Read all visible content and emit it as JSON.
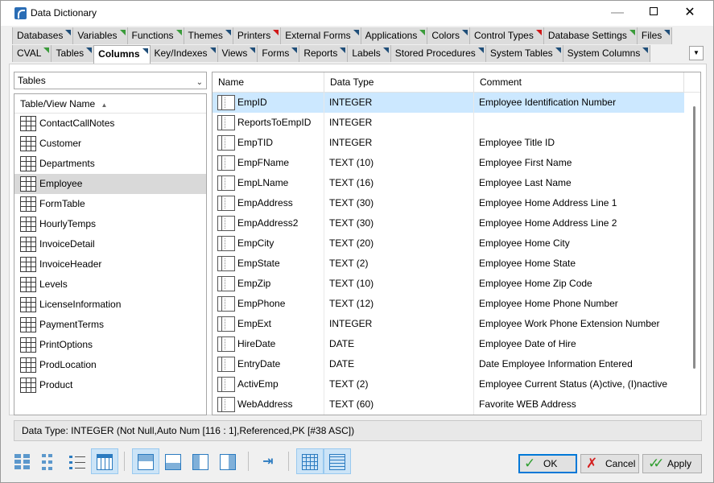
{
  "window": {
    "title": "Data Dictionary"
  },
  "tabs_row1": [
    {
      "label": "Databases",
      "flag": "blue"
    },
    {
      "label": "Variables",
      "flag": "green"
    },
    {
      "label": "Functions",
      "flag": "green"
    },
    {
      "label": "Themes",
      "flag": "blue"
    },
    {
      "label": "Printers",
      "flag": "red"
    },
    {
      "label": "External Forms",
      "flag": "blue"
    },
    {
      "label": "Applications",
      "flag": "green"
    },
    {
      "label": "Colors",
      "flag": "blue"
    },
    {
      "label": "Control Types",
      "flag": "red"
    },
    {
      "label": "Database Settings",
      "flag": "green"
    },
    {
      "label": "Files",
      "flag": "blue"
    }
  ],
  "tabs_row2": [
    {
      "label": "CVAL",
      "flag": "green"
    },
    {
      "label": "Tables",
      "flag": "blue"
    },
    {
      "label": "Columns",
      "flag": "blue",
      "active": true
    },
    {
      "label": "Key/Indexes",
      "flag": "blue"
    },
    {
      "label": "Views",
      "flag": "blue"
    },
    {
      "label": "Forms",
      "flag": "blue"
    },
    {
      "label": "Reports",
      "flag": "blue"
    },
    {
      "label": "Labels",
      "flag": "blue"
    },
    {
      "label": "Stored Procedures",
      "flag": "blue"
    },
    {
      "label": "System Tables",
      "flag": "blue"
    },
    {
      "label": "System Columns",
      "flag": "blue"
    }
  ],
  "object_type": {
    "selected": "Tables"
  },
  "table_list": {
    "header": "Table/View Name",
    "items": [
      "ContactCallNotes",
      "Customer",
      "Departments",
      "Employee",
      "FormTable",
      "HourlyTemps",
      "InvoiceDetail",
      "InvoiceHeader",
      "Levels",
      "LicenseInformation",
      "PaymentTerms",
      "PrintOptions",
      "ProdLocation",
      "Product"
    ],
    "selected": "Employee"
  },
  "columns_grid": {
    "headers": {
      "name": "Name",
      "type": "Data Type",
      "comment": "Comment"
    },
    "rows": [
      {
        "name": "EmpID",
        "type": "INTEGER",
        "comment": "Employee Identification Number"
      },
      {
        "name": "ReportsToEmpID",
        "type": "INTEGER",
        "comment": ""
      },
      {
        "name": "EmpTID",
        "type": "INTEGER",
        "comment": "Employee Title ID"
      },
      {
        "name": "EmpFName",
        "type": "TEXT (10)",
        "comment": "Employee First Name"
      },
      {
        "name": "EmpLName",
        "type": "TEXT (16)",
        "comment": "Employee Last Name"
      },
      {
        "name": "EmpAddress",
        "type": "TEXT (30)",
        "comment": "Employee Home Address Line 1"
      },
      {
        "name": "EmpAddress2",
        "type": "TEXT (30)",
        "comment": "Employee Home Address Line 2"
      },
      {
        "name": "EmpCity",
        "type": "TEXT (20)",
        "comment": "Employee Home City"
      },
      {
        "name": "EmpState",
        "type": "TEXT (2)",
        "comment": "Employee Home State"
      },
      {
        "name": "EmpZip",
        "type": "TEXT (10)",
        "comment": "Employee Home Zip Code"
      },
      {
        "name": "EmpPhone",
        "type": "TEXT (12)",
        "comment": "Employee Home Phone Number"
      },
      {
        "name": "EmpExt",
        "type": "INTEGER",
        "comment": "Employee Work Phone Extension Number"
      },
      {
        "name": "HireDate",
        "type": "DATE",
        "comment": "Employee Date of Hire"
      },
      {
        "name": "EntryDate",
        "type": "DATE",
        "comment": "Date Employee Information Entered"
      },
      {
        "name": "ActivEmp",
        "type": "TEXT (2)",
        "comment": "Employee Current Status (A)ctive, (I)nactive"
      },
      {
        "name": "WebAddress",
        "type": "TEXT (60)",
        "comment": "Favorite WEB Address"
      }
    ],
    "selected": "EmpID"
  },
  "status": {
    "text": "Data Type: INTEGER     (Not Null,Auto Num [116 : 1],Referenced,PK [#38 ASC])"
  },
  "toolbar": {
    "view_icons": [
      "large-icons-icon",
      "small-icons-icon",
      "list-view-icon",
      "details-view-icon"
    ],
    "layout_icons": [
      "layout-top-icon",
      "layout-bottom-icon",
      "layout-left-icon",
      "layout-right-icon"
    ],
    "fit_icon": "fit-columns-icon",
    "grid_icons": [
      "grid-lines-icon",
      "row-lines-icon"
    ]
  },
  "buttons": {
    "ok": "OK",
    "cancel": "Cancel",
    "apply": "Apply"
  },
  "colors": {
    "selection": "#cce8ff",
    "toolbar_active": "#cce4f7",
    "flag_blue": "#1f4e79",
    "flag_green": "#3a9b3a",
    "flag_red": "#d01818"
  }
}
